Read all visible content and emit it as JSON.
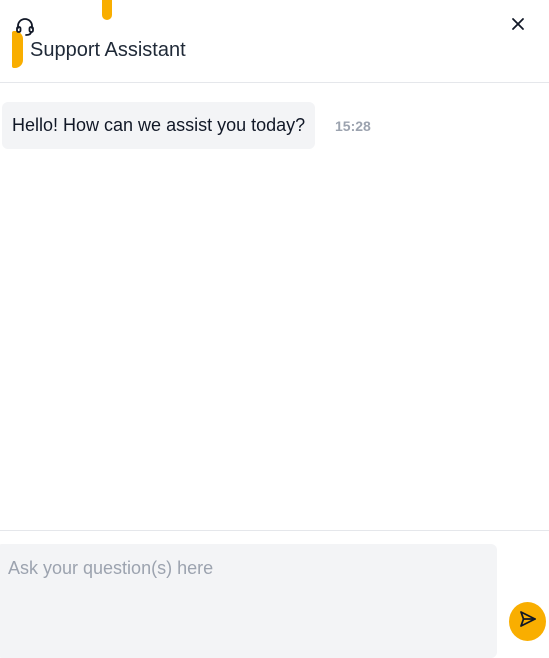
{
  "header": {
    "title": "Support Assistant",
    "icon": "headset-icon",
    "close_icon": "close-icon",
    "accent_color": "#f9ae00"
  },
  "messages": [
    {
      "sender": "assistant",
      "text": "Hello! How can we assist you today?",
      "time": "15:28"
    }
  ],
  "composer": {
    "placeholder": "Ask your question(s) here",
    "value": "",
    "send_icon": "send-icon",
    "send_color": "#f9ae00"
  }
}
